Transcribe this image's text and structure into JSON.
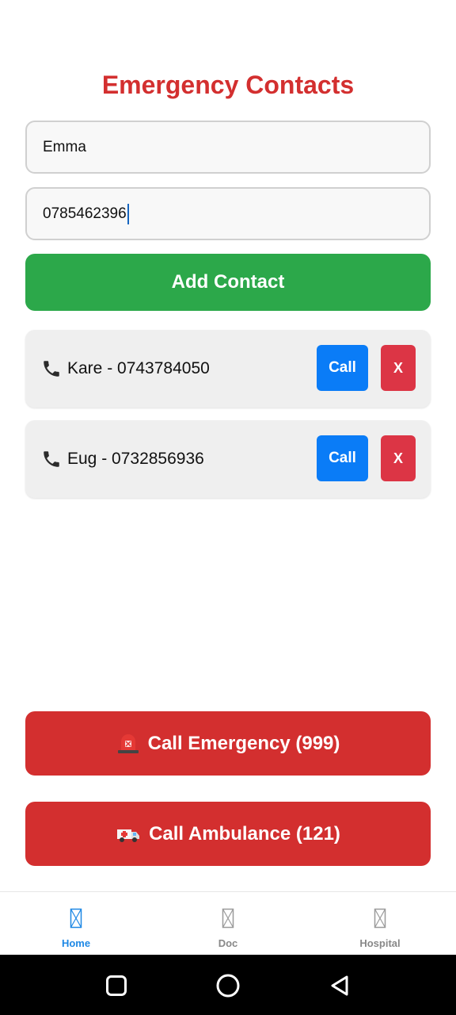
{
  "header": {
    "title": "Emergency Contacts"
  },
  "form": {
    "name_value": "Emma",
    "phone_value": "0785462396",
    "add_label": "Add Contact"
  },
  "contacts": [
    {
      "label": "Kare - 0743784050",
      "call_label": "Call",
      "delete_label": "X"
    },
    {
      "label": "Eug - 0732856936",
      "call_label": "Call",
      "delete_label": "X"
    }
  ],
  "actions": {
    "emergency_label": "Call Emergency (999)",
    "emergency_icon": "siren-icon",
    "ambulance_label": "Call Ambulance (121)",
    "ambulance_icon": "ambulance-icon"
  },
  "tabs": [
    {
      "label": "Home",
      "icon": "missing-glyph-icon",
      "active": true
    },
    {
      "label": "Doc",
      "icon": "missing-glyph-icon",
      "active": false
    },
    {
      "label": "Hospital",
      "icon": "missing-glyph-icon",
      "active": false
    }
  ],
  "colors": {
    "title": "#d32f2f",
    "add_button": "#2ca84a",
    "call_button": "#0a7cf7",
    "delete_button": "#dc3545",
    "danger_button": "#d32f2f",
    "tab_active": "#1e88e5",
    "tab_inactive": "#888888"
  }
}
